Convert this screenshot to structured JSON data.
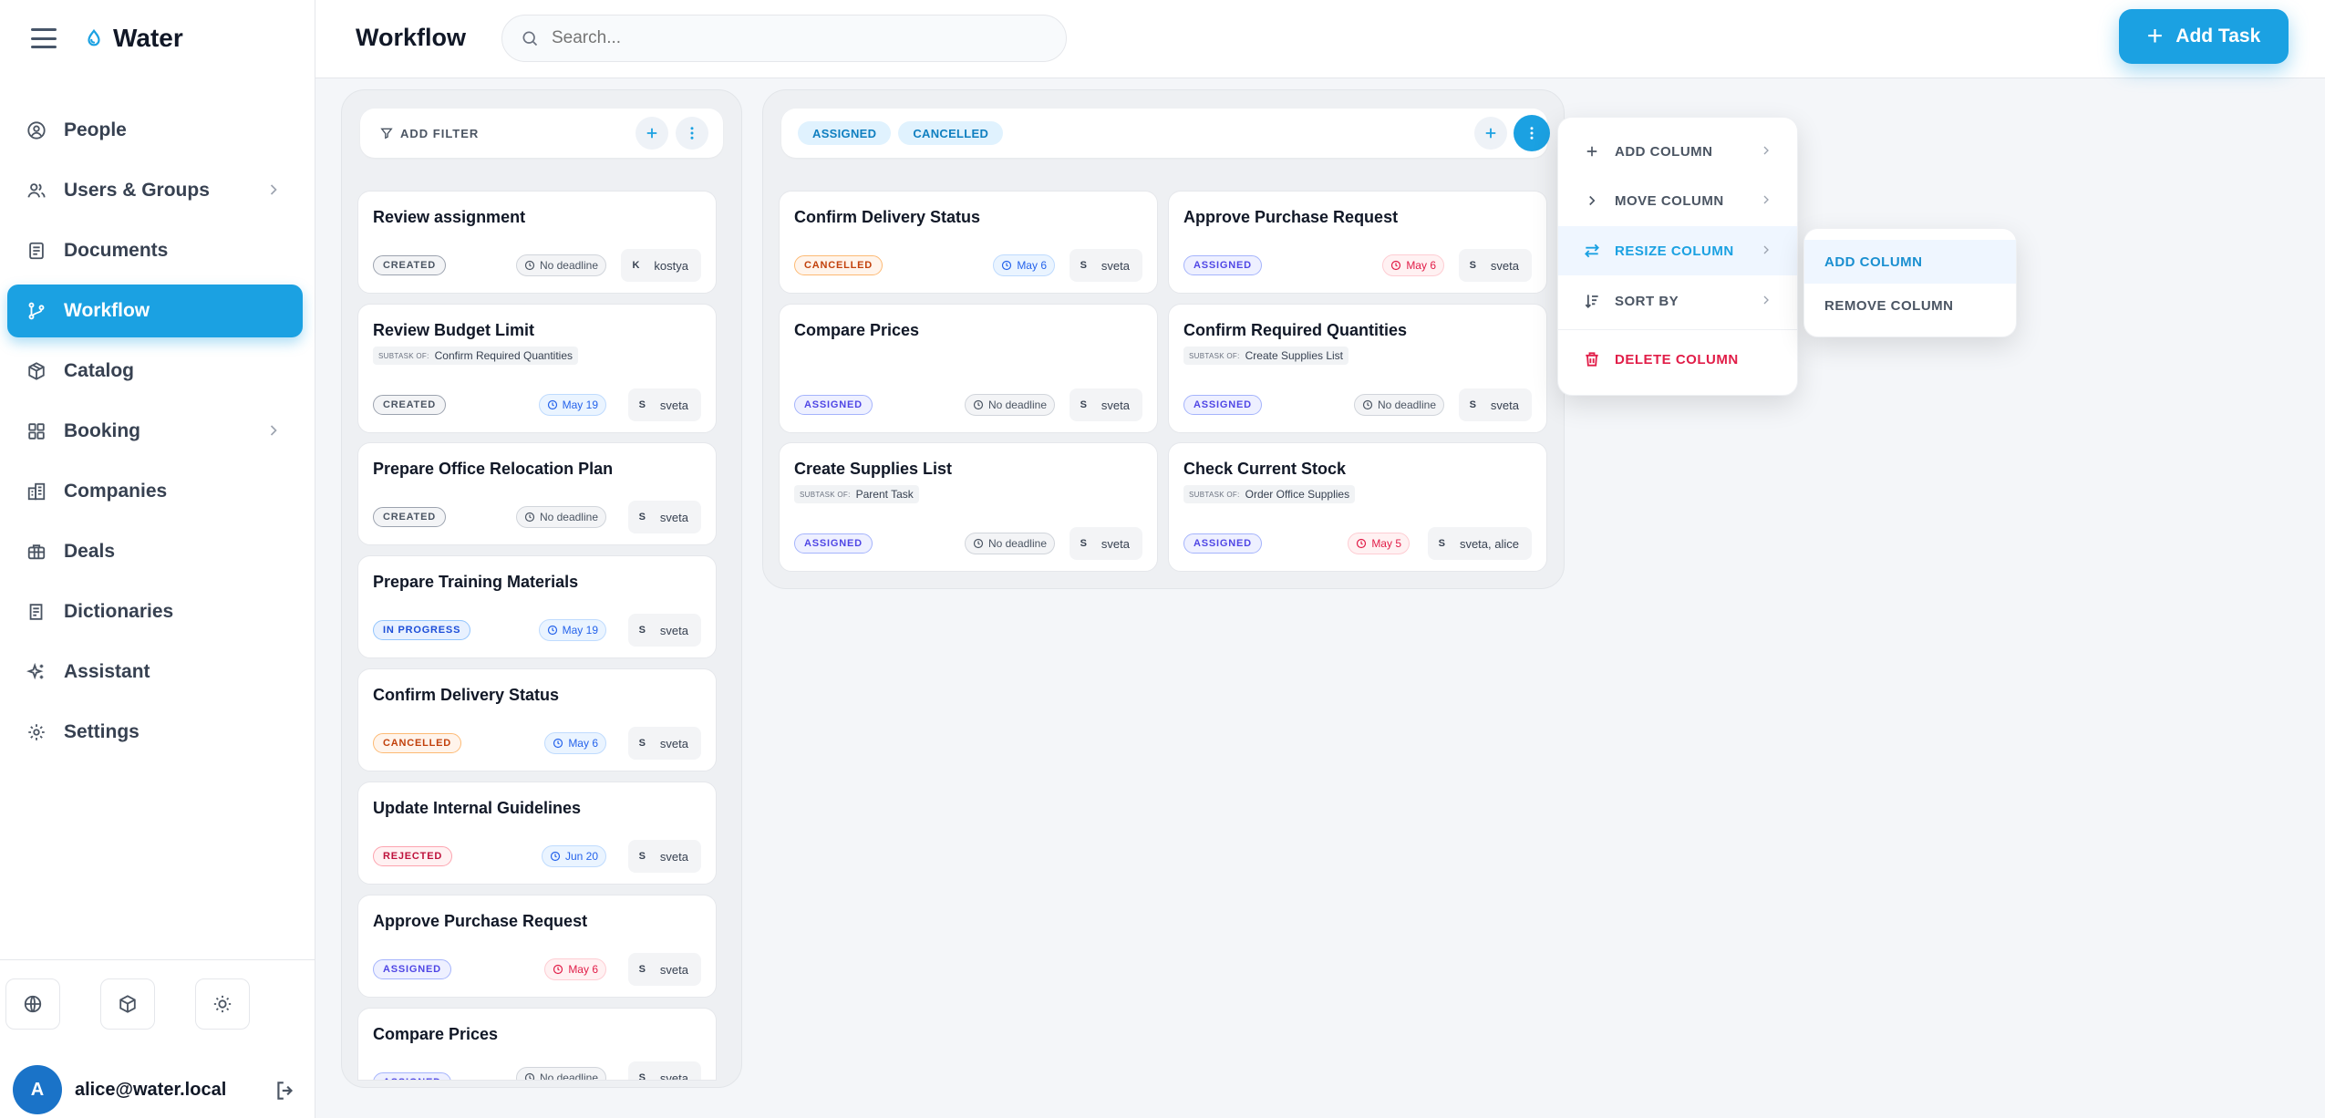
{
  "app": {
    "name": "Water"
  },
  "sidebar": {
    "items": [
      {
        "label": "People",
        "icon": "user-circle-icon"
      },
      {
        "label": "Users & Groups",
        "icon": "users-icon"
      },
      {
        "label": "Documents",
        "icon": "document-icon"
      },
      {
        "label": "Workflow",
        "icon": "workflow-icon",
        "active": true
      },
      {
        "label": "Catalog",
        "icon": "package-icon"
      },
      {
        "label": "Booking",
        "icon": "grid-icon"
      },
      {
        "label": "Companies",
        "icon": "building-icon"
      },
      {
        "label": "Deals",
        "icon": "briefcase-icon"
      },
      {
        "label": "Dictionaries",
        "icon": "book-icon"
      },
      {
        "label": "Assistant",
        "icon": "sparkles-icon"
      },
      {
        "label": "Settings",
        "icon": "gear-icon"
      }
    ],
    "user": {
      "avatar_initial": "A",
      "email": "alice@water.local"
    }
  },
  "header": {
    "title": "Workflow",
    "search_placeholder": "Search...",
    "add_task_label": "Add Task"
  },
  "columns": [
    {
      "toolbar": {
        "filter_label": "ADD FILTER"
      },
      "cards": [
        {
          "title": "Review assignment",
          "status": "CREATED",
          "status_kind": "created",
          "due": "No deadline",
          "due_kind": "none",
          "initial": "K",
          "assignee": "kostya"
        },
        {
          "title": "Review Budget Limit",
          "subtask_prefix": "SUBTASK OF:",
          "subtask": "Confirm Required Quantities",
          "status": "CREATED",
          "status_kind": "created",
          "due": "May 19",
          "due_kind": "blue",
          "initial": "S",
          "assignee": "sveta"
        },
        {
          "title": "Prepare Office Relocation Plan",
          "status": "CREATED",
          "status_kind": "created",
          "due": "No deadline",
          "due_kind": "none",
          "initial": "S",
          "assignee": "sveta"
        },
        {
          "title": "Prepare Training Materials",
          "status": "IN PROGRESS",
          "status_kind": "progress",
          "due": "May 19",
          "due_kind": "blue",
          "initial": "S",
          "assignee": "sveta"
        },
        {
          "title": "Confirm Delivery Status",
          "status": "CANCELLED",
          "status_kind": "cancelled",
          "due": "May 6",
          "due_kind": "blue",
          "initial": "S",
          "assignee": "sveta"
        },
        {
          "title": "Update Internal Guidelines",
          "status": "REJECTED",
          "status_kind": "rejected",
          "due": "Jun 20",
          "due_kind": "blue",
          "initial": "S",
          "assignee": "sveta"
        },
        {
          "title": "Approve Purchase Request",
          "status": "ASSIGNED",
          "status_kind": "assigned",
          "due": "May 6",
          "due_kind": "red",
          "initial": "S",
          "assignee": "sveta"
        },
        {
          "title": "Compare Prices",
          "status": "ASSIGNED",
          "status_kind": "assigned",
          "due": "No deadline",
          "due_kind": "none",
          "initial": "S",
          "assignee": "sveta"
        }
      ]
    },
    {
      "toolbar": {
        "chips": [
          "ASSIGNED",
          "CANCELLED"
        ]
      },
      "cards": [
        {
          "title": "Confirm Delivery Status",
          "status": "CANCELLED",
          "status_kind": "cancelled",
          "due": "May 6",
          "due_kind": "blue",
          "initial": "S",
          "assignee": "sveta"
        },
        {
          "title": "Approve Purchase Request",
          "status": "ASSIGNED",
          "status_kind": "assigned",
          "due": "May 6",
          "due_kind": "red",
          "initial": "S",
          "assignee": "sveta"
        },
        {
          "title": "Compare Prices",
          "status": "ASSIGNED",
          "status_kind": "assigned",
          "due": "No deadline",
          "due_kind": "none",
          "initial": "S",
          "assignee": "sveta"
        },
        {
          "title": "Confirm Required Quantities",
          "subtask_prefix": "SUBTASK OF:",
          "subtask": "Create Supplies List",
          "status": "ASSIGNED",
          "status_kind": "assigned",
          "due": "No deadline",
          "due_kind": "none",
          "initial": "S",
          "assignee": "sveta"
        },
        {
          "title": "Create Supplies List",
          "subtask_prefix": "SUBTASK OF:",
          "subtask": "Parent Task",
          "status": "ASSIGNED",
          "status_kind": "assigned",
          "due": "No deadline",
          "due_kind": "none",
          "initial": "S",
          "assignee": "sveta"
        },
        {
          "title": "Check Current Stock",
          "subtask_prefix": "SUBTASK OF:",
          "subtask": "Order Office Supplies",
          "status": "ASSIGNED",
          "status_kind": "assigned",
          "due": "May 5",
          "due_kind": "red",
          "initial": "S",
          "assignee": "sveta, alice"
        }
      ]
    }
  ],
  "column_menu": {
    "items": [
      {
        "label": "ADD COLUMN",
        "icon": "plus-icon",
        "has_submenu": true
      },
      {
        "label": "MOVE COLUMN",
        "icon": "chevron-right-icon",
        "has_submenu": true
      },
      {
        "label": "RESIZE COLUMN",
        "icon": "arrows-horizontal-icon",
        "has_submenu": true,
        "active": true
      },
      {
        "label": "SORT BY",
        "icon": "sort-icon",
        "has_submenu": true
      },
      {
        "label": "DELETE COLUMN",
        "icon": "trash-icon",
        "danger": true
      }
    ]
  },
  "submenu": {
    "items": [
      {
        "label": "ADD COLUMN",
        "active": true
      },
      {
        "label": "REMOVE COLUMN"
      }
    ]
  },
  "colors": {
    "accent": "#1ba1e2",
    "danger": "#e11d48",
    "background": "#f4f6f9"
  }
}
